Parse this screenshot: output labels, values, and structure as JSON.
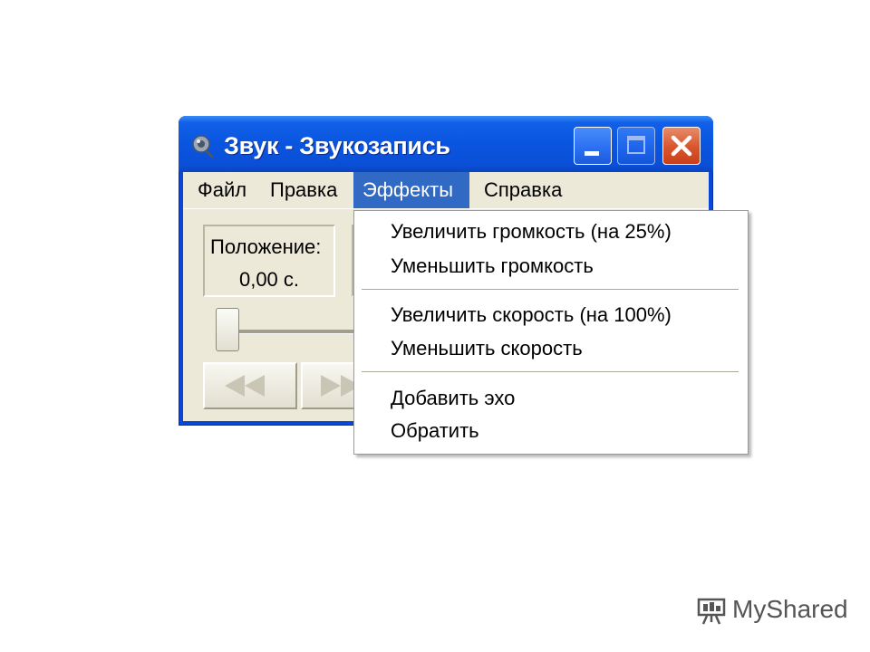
{
  "window": {
    "title": "Звук - Звукозапись"
  },
  "menubar": {
    "items": [
      {
        "label": "Файл"
      },
      {
        "label": "Правка"
      },
      {
        "label": "Эффекты",
        "active": true
      },
      {
        "label": "Справка"
      }
    ]
  },
  "position": {
    "label": "Положение:",
    "value": "0,00 с."
  },
  "effects_menu": {
    "items": [
      {
        "label": "Увеличить громкость (на 25%)"
      },
      {
        "label": "Уменьшить громкость"
      },
      {
        "label": "Увеличить скорость (на 100%)"
      },
      {
        "label": "Уменьшить скорость"
      },
      {
        "label": "Добавить эхо"
      },
      {
        "label": "Обратить"
      }
    ]
  },
  "watermark": {
    "text": "MyShared"
  },
  "colors": {
    "menu_highlight": "#316ac5",
    "titlebar": "#0a55e0",
    "client_bg": "#ece9d8",
    "close_button": "#d9542c"
  },
  "icons": {
    "app": "speaker-icon",
    "minimize": "minimize-icon",
    "maximize": "maximize-icon",
    "close": "close-icon",
    "rewind": "rewind-icon",
    "forward": "fast-forward-icon",
    "watermark": "projector-icon"
  }
}
